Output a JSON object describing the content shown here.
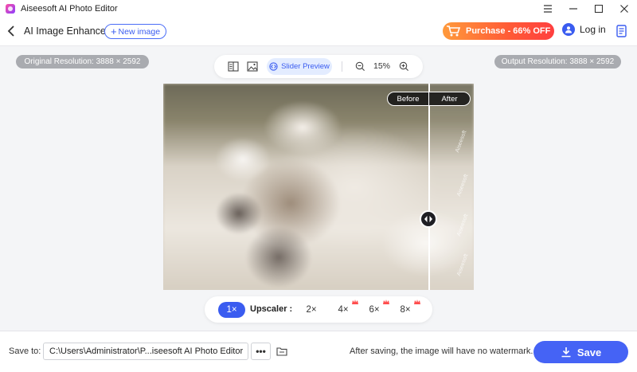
{
  "window": {
    "title": "Aiseesoft AI Photo Editor",
    "controls": [
      "menu-icon",
      "minimize-icon",
      "maximize-icon",
      "close-icon"
    ]
  },
  "toolbar": {
    "page_title": "AI Image Enhancer",
    "new_image_label": "New image",
    "purchase_label": "Purchase - 66% OFF",
    "login_label": "Log in"
  },
  "resolution": {
    "original": "Original Resolution: 3888 × 2592",
    "output": "Output Resolution: 3888 × 2592"
  },
  "view": {
    "slider_preview_label": "Slider Preview",
    "zoom_level": "15%"
  },
  "preview": {
    "before_label": "Before",
    "after_label": "After",
    "split_fraction": 0.855
  },
  "upscaler": {
    "label": "Upscaler :",
    "options": [
      {
        "label": "1×",
        "selected": true,
        "premium": false
      },
      {
        "label": "2×",
        "selected": false,
        "premium": false
      },
      {
        "label": "4×",
        "selected": false,
        "premium": true
      },
      {
        "label": "6×",
        "selected": false,
        "premium": true
      },
      {
        "label": "8×",
        "selected": false,
        "premium": true
      }
    ]
  },
  "bottom": {
    "save_to_label": "Save to:",
    "path": "C:\\Users\\Administrator\\P...iseesoft AI Photo Editor",
    "more_label": "•••",
    "watermark_note": "After saving, the image will have no watermark.",
    "save_label": "Save"
  },
  "colors": {
    "accent": "#3a5cf0",
    "purchase_start": "#ff9a3c",
    "purchase_end": "#ff3f3f",
    "save_button": "#4563f5"
  }
}
